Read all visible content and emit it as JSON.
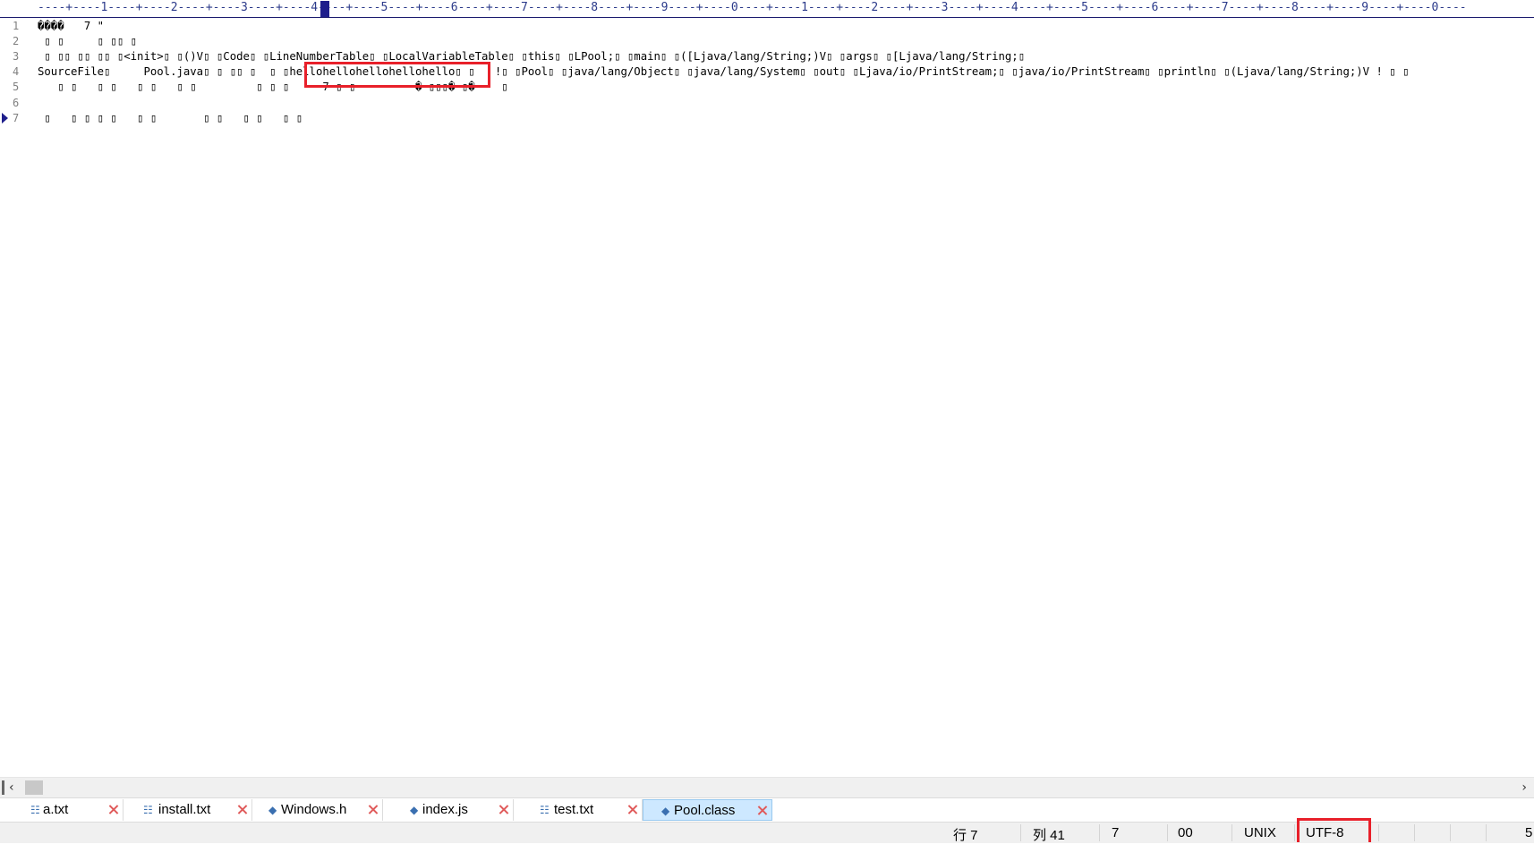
{
  "ruler": {
    "text": "----+----1----+----2----+----3----+----4----+----5----+----6----+----7----+----8----+----9----+----0----+----1----+----2----+----3----+----4----+----5----+----6----+----7----+----8----+----9----+----0----"
  },
  "editor": {
    "lines": [
      {
        "number": "1",
        "text": "����   7 \""
      },
      {
        "number": "2",
        "text": " ▯ ▯     ▯ ▯▯ ▯"
      },
      {
        "number": "3",
        "text": " ▯ ▯▯ ▯▯ ▯▯ ▯<init>▯ ▯()V▯ ▯Code▯ ▯LineNumberTable▯ ▯LocalVariableTable▯ ▯this▯ ▯LPool;▯ ▯main▯ ▯([Ljava/lang/String;)V▯ ▯args▯ ▯[Ljava/lang/String;▯"
      },
      {
        "number": "4",
        "text": "SourceFile▯     Pool.java▯ ▯ ▯▯ ▯  ▯ ▯hellohellohellohellohello▯ ▯   !▯ ▯Pool▯ ▯java/lang/Object▯ ▯java/lang/System▯ ▯out▯ ▯Ljava/io/PrintStream;▯ ▯java/io/PrintStream▯ ▯println▯ ▯(Ljava/lang/String;)V ! ▯ ▯"
      },
      {
        "number": "5",
        "text": "   ▯ ▯   ▯ ▯   ▯ ▯   ▯ ▯         ▯ ▯ ▯     7 ▯ ▯         � ▯▯▯� ▯�    ▯"
      },
      {
        "number": "6",
        "text": ""
      },
      {
        "number": "7",
        "text": " ▯   ▯ ▯ ▯ ▯   ▯ ▯       ▯ ▯   ▯ ▯   ▯ ▯"
      }
    ],
    "current_line": "7"
  },
  "tabs": [
    {
      "label": "a.txt",
      "icon": "text-file-icon"
    },
    {
      "label": "install.txt",
      "icon": "text-file-icon"
    },
    {
      "label": "Windows.h",
      "icon": "code-file-icon"
    },
    {
      "label": "index.js",
      "icon": "code-file-icon"
    },
    {
      "label": "test.txt",
      "icon": "text-file-icon"
    },
    {
      "label": "Pool.class",
      "icon": "code-file-icon",
      "active": true
    }
  ],
  "status": {
    "line": "行 7",
    "column": "列 41",
    "value": "7",
    "hex": "00",
    "line_ending": "UNIX",
    "encoding": "UTF-8",
    "extra": "5"
  },
  "colors": {
    "highlight": "#e8202a",
    "active_tab": "#cde8ff",
    "ruler_text": "#2b3a8a"
  }
}
